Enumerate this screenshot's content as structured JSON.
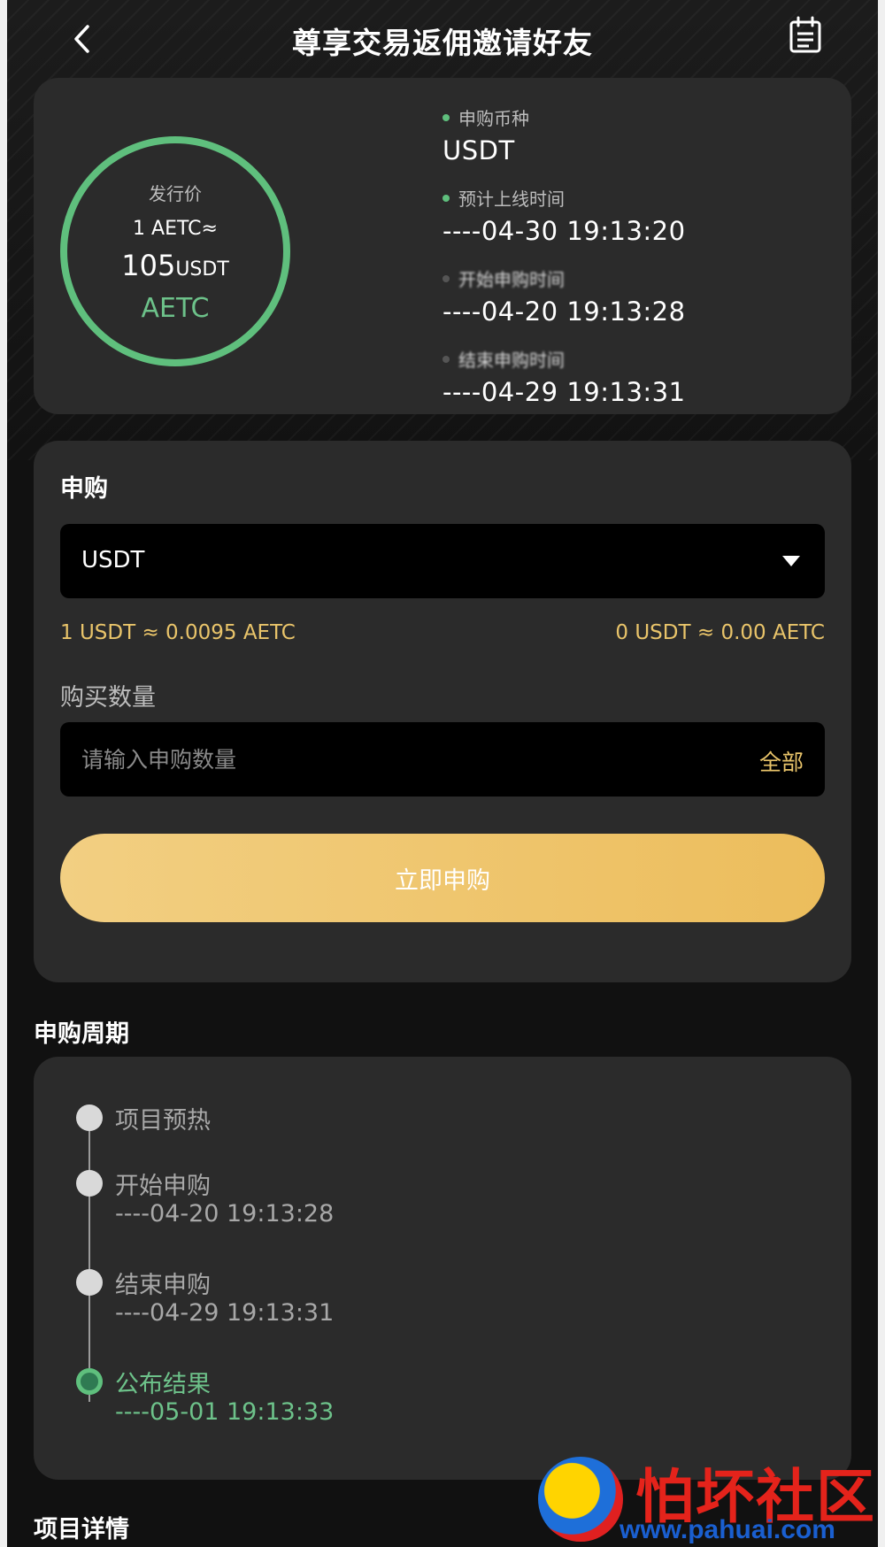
{
  "header": {
    "title": "尊享交易返佣邀请好友",
    "back_icon": "chevron-left-icon",
    "calendar_icon": "calendar-icon"
  },
  "info_card": {
    "ring": {
      "label": "发行价",
      "rate": "1 AETC≈",
      "value": "105",
      "unit": "USDT",
      "coin": "AETC"
    },
    "items": [
      {
        "label": "申购币种",
        "value": "USDT"
      },
      {
        "label": "预计上线时间",
        "value": "----04-30 19:13:20"
      },
      {
        "label": "开始申购时间",
        "value": "----04-20 19:13:28"
      },
      {
        "label": "结束申购时间",
        "value": "----04-29 19:13:31"
      }
    ]
  },
  "subscribe": {
    "title": "申购",
    "currency": "USDT",
    "rate_left": "1 USDT ≈ 0.0095 AETC",
    "rate_right": "0 USDT ≈ 0.00 AETC",
    "quantity_label": "购买数量",
    "quantity_placeholder": "请输入申购数量",
    "all_label": "全部",
    "submit_label": "立即申购"
  },
  "cycle": {
    "title": "申购周期",
    "steps": [
      {
        "name": "项目预热",
        "time": ""
      },
      {
        "name": "开始申购",
        "time": "----04-20 19:13:28"
      },
      {
        "name": "结束申购",
        "time": "----04-29 19:13:31"
      },
      {
        "name": "公布结果",
        "time": "----05-01 19:13:33"
      }
    ]
  },
  "details": {
    "title": "项目详情"
  },
  "watermark": {
    "text": "怕坏社区",
    "url": "www.pahuai.com"
  },
  "colors": {
    "accent_green": "#5fbf7d",
    "accent_gold": "#ecbd5c",
    "card_bg": "#2b2b2b"
  }
}
